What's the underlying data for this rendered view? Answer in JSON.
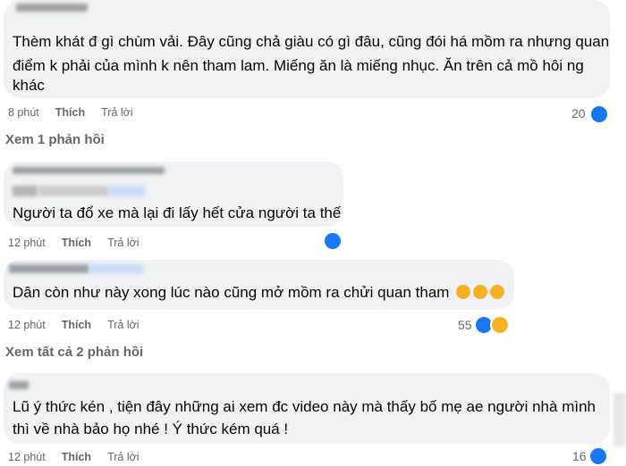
{
  "comments": [
    {
      "author": "Vân Anh Trần",
      "text_lines": [
        "Thèm khát đ gì chùm vải. Đây cũng chả giàu có gì đâu, cũng đói há mồm ra nhưng quan",
        "điểm k phải của mình k nên tham lam. Miếng ăn là miếng nhục. Ăn trên cả mồ hôi ng",
        "khác"
      ],
      "time": "8 phút",
      "like_label": "Thích",
      "reply_label": "Trả lời",
      "reaction_count": "20",
      "view_replies": "Xem 1 phản hồi"
    },
    {
      "author": "",
      "text_lines": [
        "Người ta đổ xe mà lại đi lấy hết cửa người ta thế"
      ],
      "time": "12 phút",
      "like_label": "Thích",
      "reply_label": "Trả lời",
      "reaction_count": ""
    },
    {
      "author": "",
      "text_lines": [
        "Dân còn như này xong lúc nào cũng mở mồm ra chửi quan tham"
      ],
      "time": "12 phút",
      "like_label": "Thích",
      "reply_label": "Trả lời",
      "reaction_count": "55",
      "view_replies": "Xem tất cả 2 phản hồi"
    },
    {
      "author": "",
      "text_lines": [
        "Lũ ý thức kén , tiện đây những ai xem đc video này mà thấy bố mẹ ae người nhà mình",
        "thì về nhà bảo họ nhé ! Ý thức kém quá !"
      ],
      "time": "12 phút",
      "like_label": "Thích",
      "reply_label": "Trả lời",
      "reaction_count": "16"
    }
  ],
  "colors": {
    "bubble": "#f0f2f5",
    "like_blue": "#1877f2",
    "haha_yellow": "#f7b125",
    "meta_gray": "#65676b"
  },
  "icons": [
    "like-reaction-icon",
    "haha-reaction-icon"
  ]
}
